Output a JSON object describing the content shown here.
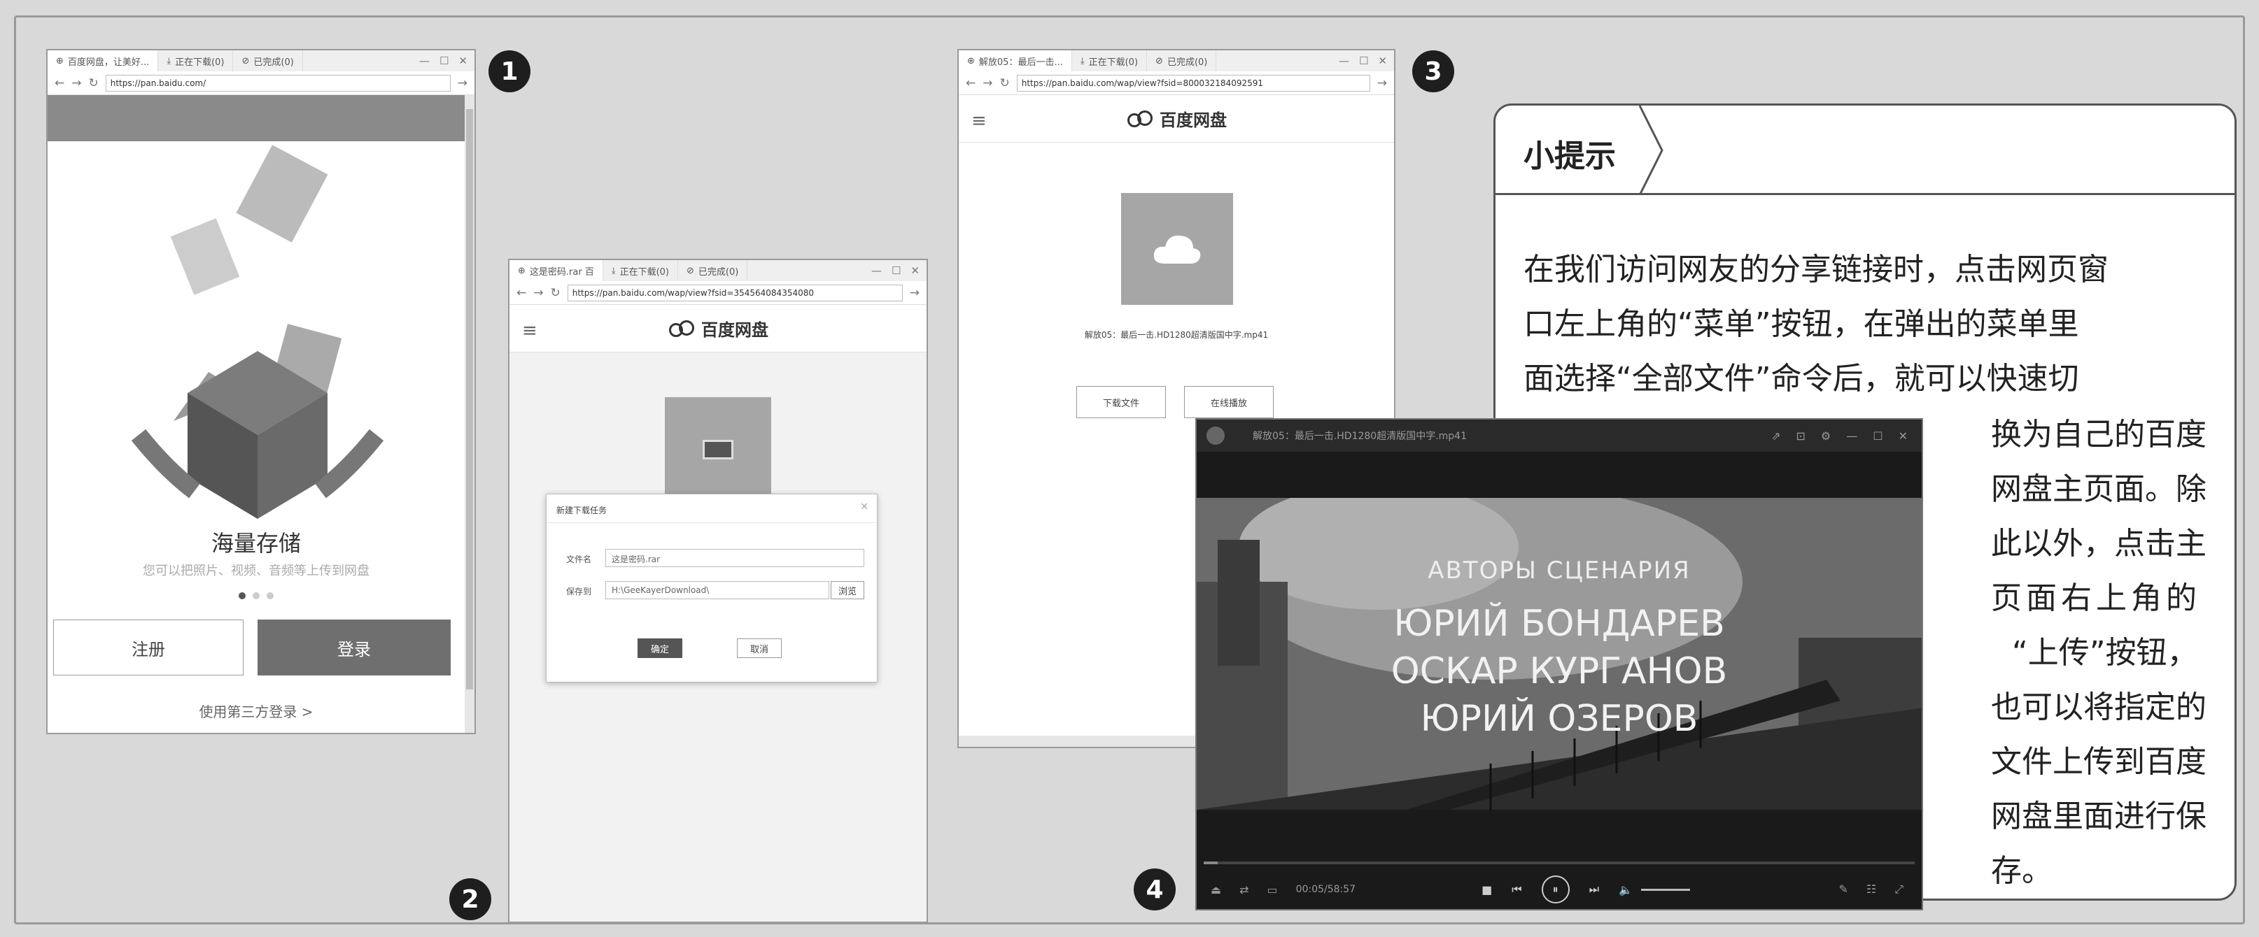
{
  "badges": {
    "one": "1",
    "two": "2",
    "three": "3",
    "four": "4"
  },
  "win1": {
    "tabs": [
      "百度网盘，让美好...",
      "正在下载(0)",
      "已完成(0)"
    ],
    "url": "https://pan.baidu.com/",
    "storage_title": "海量存储",
    "storage_sub": "您可以把照片、视频、音频等上传到网盘",
    "register": "注册",
    "login": "登录",
    "third_party": "使用第三方登录 >"
  },
  "win2": {
    "tabs": [
      "这是密码.rar 百",
      "正在下载(0)",
      "已完成(0)"
    ],
    "url": "https://pan.baidu.com/wap/view?fsid=354564084354080",
    "brand": "百度网盘",
    "dialog_title": "新建下载任务",
    "filename_label": "文件名",
    "filename_value": "这是密码.rar",
    "saveto_label": "保存到",
    "saveto_value": "H:\\GeeKayerDownload\\",
    "browse": "浏览",
    "ok": "确定",
    "cancel": "取消"
  },
  "win3": {
    "tabs": [
      "解放05：最后一击...",
      "正在下载(0)",
      "已完成(0)"
    ],
    "url": "https://pan.baidu.com/wap/view?fsid=800032184092591",
    "brand": "百度网盘",
    "filename": "解放05：最后一击.HD1280超清版国中字.mp41",
    "download": "下载文件",
    "play": "在线播放"
  },
  "player": {
    "title": "解放05：最后一击.HD1280超清版国中字.mp41",
    "line1": "АВТОРЫ СЦЕНАРИЯ",
    "line2": "ЮРИЙ БОНДАРЕВ",
    "line3": "ОСКАР КУРГАНОВ",
    "line4": "ЮРИЙ ОЗЕРОВ",
    "time": "00:05/58:57"
  },
  "tip": {
    "header": "小提示",
    "line1": "在我们访问网友的分享链接时，点击网页窗",
    "line2": "口左上角的“菜单”按钮，在弹出的菜单里",
    "line3": "面选择“全部文件”命令后，就可以快速切",
    "narrow": [
      "换为自己的百度",
      "网盘主页面。除",
      "此以外，点击主",
      "页面右上角的",
      "“上传”按钮，",
      "也可以将指定的",
      "文件上传到百度",
      "网盘里面进行保",
      "存。"
    ]
  }
}
